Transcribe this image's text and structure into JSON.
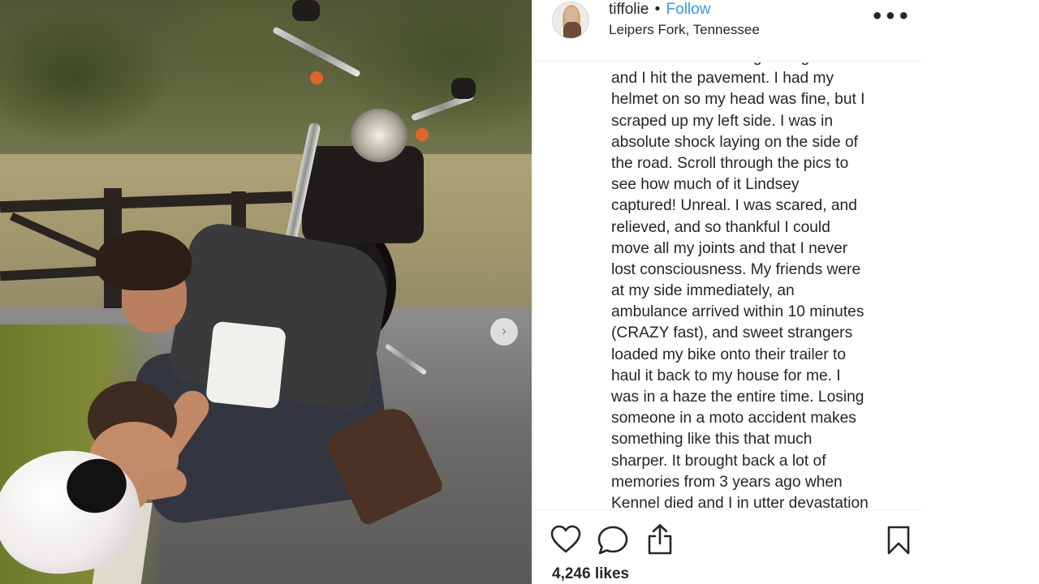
{
  "post": {
    "username": "tiffolie",
    "separator": "•",
    "follow_label": "Follow",
    "location": "Leipers Fork, Tennessee",
    "more_icon": "more-horizontal-icon",
    "caption_lines": [
      "the road. It slid through the grass",
      "and I hit the pavement. I had my",
      "helmet on so my head was fine, but I",
      "scraped up my left side. I was in",
      "absolute shock laying on the side of",
      "the road. Scroll through the pics to",
      "see how much of it Lindsey",
      "captured! Unreal. I was scared, and",
      "relieved, and so thankful I could",
      "move all my joints and that I never",
      "lost consciousness. My friends were",
      "at my side immediately, an",
      "ambulance arrived within 10 minutes",
      "(CRAZY fast), and sweet strangers",
      "loaded my bike onto their trailer to",
      "haul it back to my house for me. I",
      "was in a haze the entire time. Losing",
      "someone in a moto accident makes",
      "something like this that much",
      "sharper. It brought back a lot of",
      "memories from 3 years ago when",
      "Kennel died and I in utter devastation"
    ],
    "likes_label": "4,246 likes"
  },
  "carousel": {
    "next_glyph": "›"
  },
  "actions": {
    "like_icon": "heart-icon",
    "comment_icon": "comment-icon",
    "share_icon": "share-icon",
    "save_icon": "bookmark-icon"
  },
  "colors": {
    "link_blue": "#3897f0",
    "text": "#262626",
    "divider": "#efefef"
  }
}
